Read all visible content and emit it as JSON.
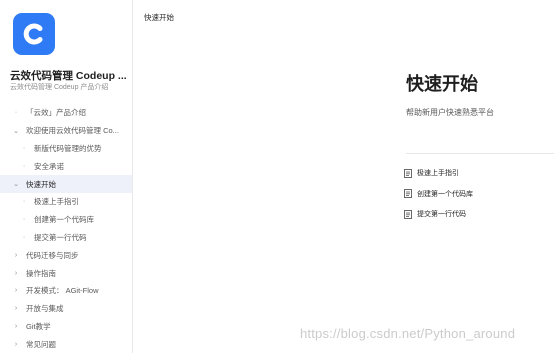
{
  "sidebar": {
    "product_title": "云效代码管理 Codeup ...",
    "product_subtitle": "云效代码管理 Codeup 产品介绍",
    "items": [
      {
        "mark": "·",
        "label": "「云效」产品介绍"
      },
      {
        "mark": "⌄",
        "label": "欢迎使用云效代码管理 Co..."
      },
      {
        "mark": "·",
        "label": "新版代码管理的优势"
      },
      {
        "mark": "·",
        "label": "安全承诺"
      },
      {
        "mark": "⌄",
        "label": "快速开始"
      },
      {
        "mark": "·",
        "label": "极速上手指引"
      },
      {
        "mark": "·",
        "label": "创建第一个代码库"
      },
      {
        "mark": "·",
        "label": "提交第一行代码"
      },
      {
        "mark": "›",
        "label": "代码迁移与同步"
      },
      {
        "mark": "›",
        "label": "操作指南"
      },
      {
        "mark": "›",
        "label": "开发模式： AGit-Flow"
      },
      {
        "mark": "›",
        "label": "开放与集成"
      },
      {
        "mark": "›",
        "label": "Git教学"
      },
      {
        "mark": "›",
        "label": "常见问题"
      }
    ]
  },
  "breadcrumb": "快速开始",
  "main": {
    "title": "快速开始",
    "subtitle": "帮助新用户快速熟悉平台",
    "links": [
      "极速上手指引",
      "创建第一个代码库",
      "提交第一行代码"
    ]
  },
  "watermark": "https://blog.csdn.net/Python_around",
  "colors": {
    "brand": "#2f7bf5",
    "active_bg": "#eef0fa"
  }
}
